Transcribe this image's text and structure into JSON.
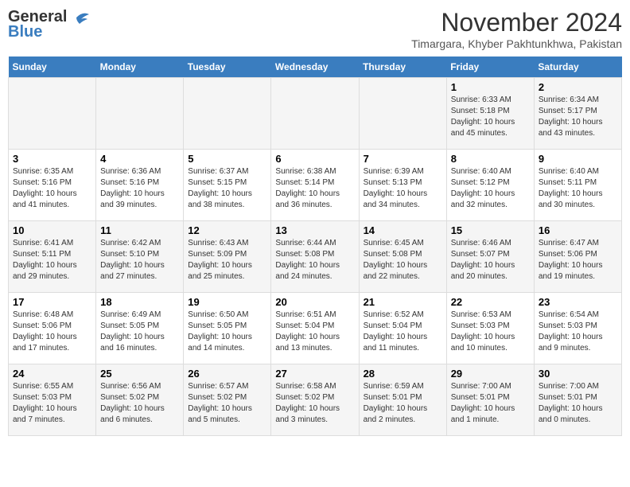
{
  "header": {
    "logo_general": "General",
    "logo_blue": "Blue",
    "month_year": "November 2024",
    "location": "Timargara, Khyber Pakhtunkhwa, Pakistan"
  },
  "calendar": {
    "days_of_week": [
      "Sunday",
      "Monday",
      "Tuesday",
      "Wednesday",
      "Thursday",
      "Friday",
      "Saturday"
    ],
    "weeks": [
      [
        {
          "day": "",
          "info": ""
        },
        {
          "day": "",
          "info": ""
        },
        {
          "day": "",
          "info": ""
        },
        {
          "day": "",
          "info": ""
        },
        {
          "day": "",
          "info": ""
        },
        {
          "day": "1",
          "info": "Sunrise: 6:33 AM\nSunset: 5:18 PM\nDaylight: 10 hours and 45 minutes."
        },
        {
          "day": "2",
          "info": "Sunrise: 6:34 AM\nSunset: 5:17 PM\nDaylight: 10 hours and 43 minutes."
        }
      ],
      [
        {
          "day": "3",
          "info": "Sunrise: 6:35 AM\nSunset: 5:16 PM\nDaylight: 10 hours and 41 minutes."
        },
        {
          "day": "4",
          "info": "Sunrise: 6:36 AM\nSunset: 5:16 PM\nDaylight: 10 hours and 39 minutes."
        },
        {
          "day": "5",
          "info": "Sunrise: 6:37 AM\nSunset: 5:15 PM\nDaylight: 10 hours and 38 minutes."
        },
        {
          "day": "6",
          "info": "Sunrise: 6:38 AM\nSunset: 5:14 PM\nDaylight: 10 hours and 36 minutes."
        },
        {
          "day": "7",
          "info": "Sunrise: 6:39 AM\nSunset: 5:13 PM\nDaylight: 10 hours and 34 minutes."
        },
        {
          "day": "8",
          "info": "Sunrise: 6:40 AM\nSunset: 5:12 PM\nDaylight: 10 hours and 32 minutes."
        },
        {
          "day": "9",
          "info": "Sunrise: 6:40 AM\nSunset: 5:11 PM\nDaylight: 10 hours and 30 minutes."
        }
      ],
      [
        {
          "day": "10",
          "info": "Sunrise: 6:41 AM\nSunset: 5:11 PM\nDaylight: 10 hours and 29 minutes."
        },
        {
          "day": "11",
          "info": "Sunrise: 6:42 AM\nSunset: 5:10 PM\nDaylight: 10 hours and 27 minutes."
        },
        {
          "day": "12",
          "info": "Sunrise: 6:43 AM\nSunset: 5:09 PM\nDaylight: 10 hours and 25 minutes."
        },
        {
          "day": "13",
          "info": "Sunrise: 6:44 AM\nSunset: 5:08 PM\nDaylight: 10 hours and 24 minutes."
        },
        {
          "day": "14",
          "info": "Sunrise: 6:45 AM\nSunset: 5:08 PM\nDaylight: 10 hours and 22 minutes."
        },
        {
          "day": "15",
          "info": "Sunrise: 6:46 AM\nSunset: 5:07 PM\nDaylight: 10 hours and 20 minutes."
        },
        {
          "day": "16",
          "info": "Sunrise: 6:47 AM\nSunset: 5:06 PM\nDaylight: 10 hours and 19 minutes."
        }
      ],
      [
        {
          "day": "17",
          "info": "Sunrise: 6:48 AM\nSunset: 5:06 PM\nDaylight: 10 hours and 17 minutes."
        },
        {
          "day": "18",
          "info": "Sunrise: 6:49 AM\nSunset: 5:05 PM\nDaylight: 10 hours and 16 minutes."
        },
        {
          "day": "19",
          "info": "Sunrise: 6:50 AM\nSunset: 5:05 PM\nDaylight: 10 hours and 14 minutes."
        },
        {
          "day": "20",
          "info": "Sunrise: 6:51 AM\nSunset: 5:04 PM\nDaylight: 10 hours and 13 minutes."
        },
        {
          "day": "21",
          "info": "Sunrise: 6:52 AM\nSunset: 5:04 PM\nDaylight: 10 hours and 11 minutes."
        },
        {
          "day": "22",
          "info": "Sunrise: 6:53 AM\nSunset: 5:03 PM\nDaylight: 10 hours and 10 minutes."
        },
        {
          "day": "23",
          "info": "Sunrise: 6:54 AM\nSunset: 5:03 PM\nDaylight: 10 hours and 9 minutes."
        }
      ],
      [
        {
          "day": "24",
          "info": "Sunrise: 6:55 AM\nSunset: 5:03 PM\nDaylight: 10 hours and 7 minutes."
        },
        {
          "day": "25",
          "info": "Sunrise: 6:56 AM\nSunset: 5:02 PM\nDaylight: 10 hours and 6 minutes."
        },
        {
          "day": "26",
          "info": "Sunrise: 6:57 AM\nSunset: 5:02 PM\nDaylight: 10 hours and 5 minutes."
        },
        {
          "day": "27",
          "info": "Sunrise: 6:58 AM\nSunset: 5:02 PM\nDaylight: 10 hours and 3 minutes."
        },
        {
          "day": "28",
          "info": "Sunrise: 6:59 AM\nSunset: 5:01 PM\nDaylight: 10 hours and 2 minutes."
        },
        {
          "day": "29",
          "info": "Sunrise: 7:00 AM\nSunset: 5:01 PM\nDaylight: 10 hours and 1 minute."
        },
        {
          "day": "30",
          "info": "Sunrise: 7:00 AM\nSunset: 5:01 PM\nDaylight: 10 hours and 0 minutes."
        }
      ]
    ]
  }
}
